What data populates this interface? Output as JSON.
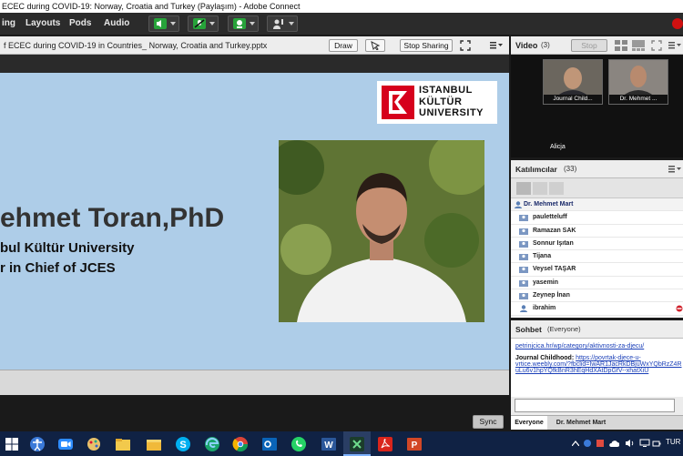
{
  "window": {
    "title": "ECEC during COVID-19:  Norway, Croatia and Turkey (Paylaşım) - Adobe Connect"
  },
  "menubar": {
    "items": [
      {
        "label": "ing"
      },
      {
        "label": "Layouts"
      },
      {
        "label": "Pods"
      },
      {
        "label": "Audio"
      }
    ]
  },
  "share_pod": {
    "title": "f ECEC during COVID-19 in Countries_ Norway, Croatia and Turkey.pptx",
    "draw_label": "Draw",
    "stop_sharing_label": "Stop Sharing",
    "sync_label": "Sync"
  },
  "slide": {
    "logo_line1": "ISTANBUL",
    "logo_line2": "KÜLTÜR",
    "logo_line3": "UNIVERSITY",
    "name": "ehmet Toran,PhD",
    "line2": "bul Kültür University",
    "line3": "r in Chief of JCES"
  },
  "video_pod": {
    "label": "Video",
    "count": "(3)",
    "stop_label": "Stop",
    "tiles": [
      {
        "name": "Journal Child..."
      },
      {
        "name": "Dr. Mehmet ..."
      }
    ],
    "third_participant": "Alicja"
  },
  "attendees": {
    "label": "Katılımcılar",
    "count": "(33)",
    "host": "Dr. Mehmet Mart",
    "list": [
      {
        "name": "pauletteluff"
      },
      {
        "name": "Ramazan SAK"
      },
      {
        "name": "Sonnur Işıtan"
      },
      {
        "name": "Tijana"
      },
      {
        "name": "Veysel TAŞAR"
      },
      {
        "name": "yasemin"
      },
      {
        "name": "Zeynep İnan"
      },
      {
        "name": "ibrahim"
      }
    ]
  },
  "chat": {
    "label": "Sohbet",
    "audience": "(Everyone)",
    "link1": "petrinjcica.hr/wp/category/aktivnosti-za-djecu/",
    "sender": "Journal Childhood:",
    "link2a": "https://povrtak-djece-u-",
    "link2b": "vrtice.weebly.com/?fbclid=IwAR1JacRkDBjuWxYQbRzZ4R",
    "link2c": "uLu6v1hpYQfkBnR3hEqHdXAtDpGfV--xhatXiU",
    "tabs": [
      {
        "label": "Everyone"
      },
      {
        "label": "Dr. Mehmet Mart"
      }
    ]
  },
  "taskbar": {
    "language": "TUR"
  },
  "colors": {
    "slide_background": "#aecde8",
    "logo_red": "#d6001c",
    "link_blue": "#1a3fb8",
    "record_red": "#d01010"
  }
}
